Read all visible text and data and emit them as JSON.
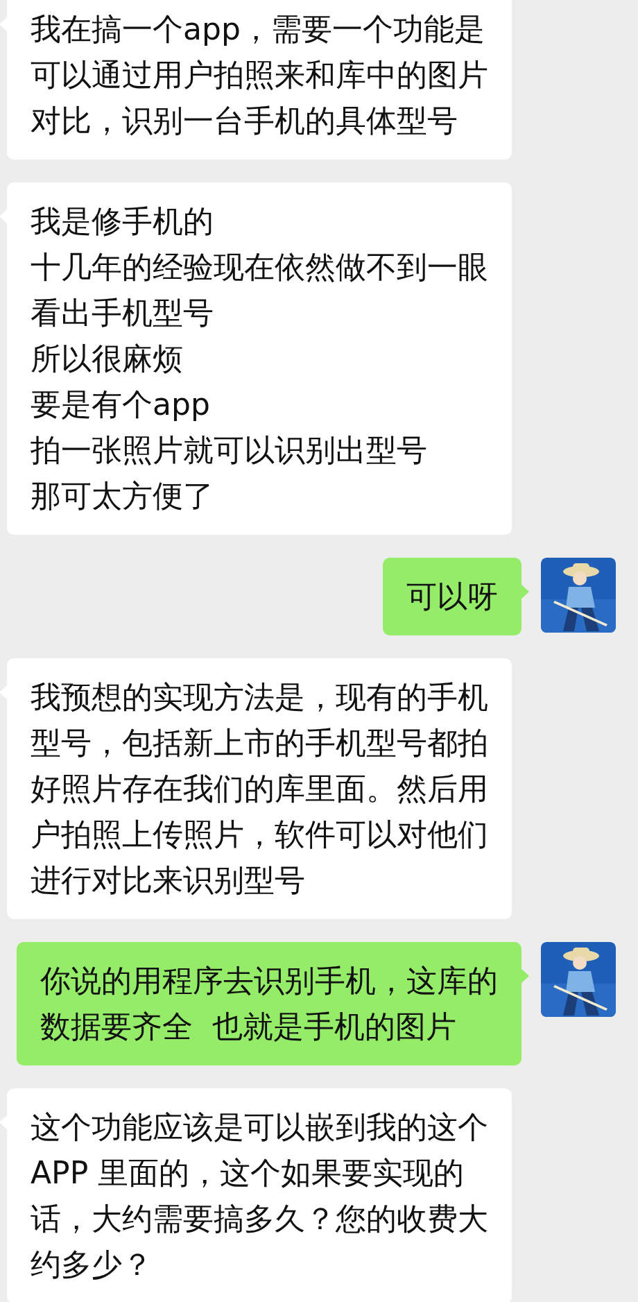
{
  "messages": [
    {
      "kind": "incoming",
      "lines": [
        "我在搞一个app，需要一个功能是",
        "可以通过用户拍照来和库中的图片",
        "对比，识别一台手机的具体型号"
      ]
    },
    {
      "kind": "incoming",
      "lines": [
        "我是修手机的",
        "十几年的经验现在依然做不到一眼",
        "看出手机型号",
        "所以很麻烦",
        "要是有个app",
        "拍一张照片就可以识别出型号",
        "那可太方便了"
      ]
    },
    {
      "kind": "outgoing",
      "lines": [
        "可以呀"
      ],
      "avatar": {
        "kind": "picture"
      }
    },
    {
      "kind": "incoming",
      "lines": [
        "我预想的实现方法是，现有的手机",
        "型号，包括新上市的手机型号都拍",
        "好照片存在我们的库里面。然后用",
        "户拍照上传照片，软件可以对他们",
        "进行对比来识别型号"
      ]
    },
    {
      "kind": "outgoing",
      "lines": [
        "你说的用程序去识别手机，这库的",
        "数据要齐全  也就是手机的图片"
      ],
      "avatar": {
        "kind": "picture"
      }
    },
    {
      "kind": "incoming",
      "lines": [
        "这个功能应该是可以嵌到我的这个",
        "APP 里面的，这个如果要实现的",
        "话，大约需要搞多久？您的收费大",
        "约多少？"
      ]
    }
  ]
}
